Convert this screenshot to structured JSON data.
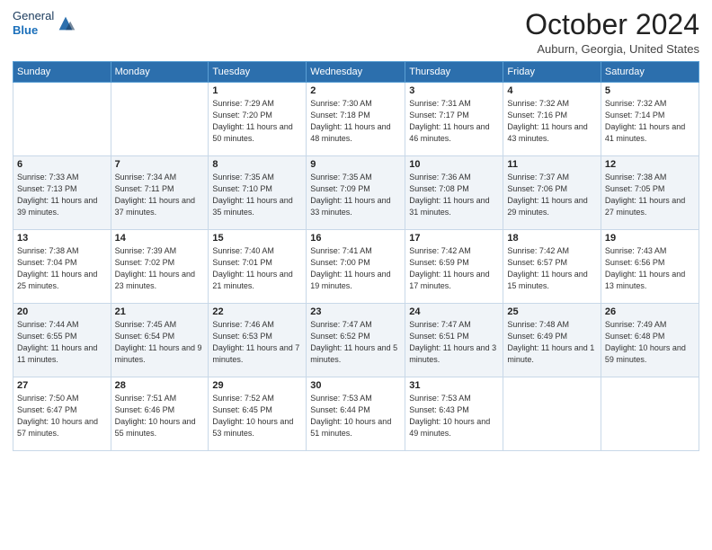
{
  "header": {
    "logo_line1": "General",
    "logo_line2": "Blue",
    "month": "October 2024",
    "location": "Auburn, Georgia, United States"
  },
  "weekdays": [
    "Sunday",
    "Monday",
    "Tuesday",
    "Wednesday",
    "Thursday",
    "Friday",
    "Saturday"
  ],
  "weeks": [
    [
      {
        "day": "",
        "info": ""
      },
      {
        "day": "",
        "info": ""
      },
      {
        "day": "1",
        "info": "Sunrise: 7:29 AM\nSunset: 7:20 PM\nDaylight: 11 hours and 50 minutes."
      },
      {
        "day": "2",
        "info": "Sunrise: 7:30 AM\nSunset: 7:18 PM\nDaylight: 11 hours and 48 minutes."
      },
      {
        "day": "3",
        "info": "Sunrise: 7:31 AM\nSunset: 7:17 PM\nDaylight: 11 hours and 46 minutes."
      },
      {
        "day": "4",
        "info": "Sunrise: 7:32 AM\nSunset: 7:16 PM\nDaylight: 11 hours and 43 minutes."
      },
      {
        "day": "5",
        "info": "Sunrise: 7:32 AM\nSunset: 7:14 PM\nDaylight: 11 hours and 41 minutes."
      }
    ],
    [
      {
        "day": "6",
        "info": "Sunrise: 7:33 AM\nSunset: 7:13 PM\nDaylight: 11 hours and 39 minutes."
      },
      {
        "day": "7",
        "info": "Sunrise: 7:34 AM\nSunset: 7:11 PM\nDaylight: 11 hours and 37 minutes."
      },
      {
        "day": "8",
        "info": "Sunrise: 7:35 AM\nSunset: 7:10 PM\nDaylight: 11 hours and 35 minutes."
      },
      {
        "day": "9",
        "info": "Sunrise: 7:35 AM\nSunset: 7:09 PM\nDaylight: 11 hours and 33 minutes."
      },
      {
        "day": "10",
        "info": "Sunrise: 7:36 AM\nSunset: 7:08 PM\nDaylight: 11 hours and 31 minutes."
      },
      {
        "day": "11",
        "info": "Sunrise: 7:37 AM\nSunset: 7:06 PM\nDaylight: 11 hours and 29 minutes."
      },
      {
        "day": "12",
        "info": "Sunrise: 7:38 AM\nSunset: 7:05 PM\nDaylight: 11 hours and 27 minutes."
      }
    ],
    [
      {
        "day": "13",
        "info": "Sunrise: 7:38 AM\nSunset: 7:04 PM\nDaylight: 11 hours and 25 minutes."
      },
      {
        "day": "14",
        "info": "Sunrise: 7:39 AM\nSunset: 7:02 PM\nDaylight: 11 hours and 23 minutes."
      },
      {
        "day": "15",
        "info": "Sunrise: 7:40 AM\nSunset: 7:01 PM\nDaylight: 11 hours and 21 minutes."
      },
      {
        "day": "16",
        "info": "Sunrise: 7:41 AM\nSunset: 7:00 PM\nDaylight: 11 hours and 19 minutes."
      },
      {
        "day": "17",
        "info": "Sunrise: 7:42 AM\nSunset: 6:59 PM\nDaylight: 11 hours and 17 minutes."
      },
      {
        "day": "18",
        "info": "Sunrise: 7:42 AM\nSunset: 6:57 PM\nDaylight: 11 hours and 15 minutes."
      },
      {
        "day": "19",
        "info": "Sunrise: 7:43 AM\nSunset: 6:56 PM\nDaylight: 11 hours and 13 minutes."
      }
    ],
    [
      {
        "day": "20",
        "info": "Sunrise: 7:44 AM\nSunset: 6:55 PM\nDaylight: 11 hours and 11 minutes."
      },
      {
        "day": "21",
        "info": "Sunrise: 7:45 AM\nSunset: 6:54 PM\nDaylight: 11 hours and 9 minutes."
      },
      {
        "day": "22",
        "info": "Sunrise: 7:46 AM\nSunset: 6:53 PM\nDaylight: 11 hours and 7 minutes."
      },
      {
        "day": "23",
        "info": "Sunrise: 7:47 AM\nSunset: 6:52 PM\nDaylight: 11 hours and 5 minutes."
      },
      {
        "day": "24",
        "info": "Sunrise: 7:47 AM\nSunset: 6:51 PM\nDaylight: 11 hours and 3 minutes."
      },
      {
        "day": "25",
        "info": "Sunrise: 7:48 AM\nSunset: 6:49 PM\nDaylight: 11 hours and 1 minute."
      },
      {
        "day": "26",
        "info": "Sunrise: 7:49 AM\nSunset: 6:48 PM\nDaylight: 10 hours and 59 minutes."
      }
    ],
    [
      {
        "day": "27",
        "info": "Sunrise: 7:50 AM\nSunset: 6:47 PM\nDaylight: 10 hours and 57 minutes."
      },
      {
        "day": "28",
        "info": "Sunrise: 7:51 AM\nSunset: 6:46 PM\nDaylight: 10 hours and 55 minutes."
      },
      {
        "day": "29",
        "info": "Sunrise: 7:52 AM\nSunset: 6:45 PM\nDaylight: 10 hours and 53 minutes."
      },
      {
        "day": "30",
        "info": "Sunrise: 7:53 AM\nSunset: 6:44 PM\nDaylight: 10 hours and 51 minutes."
      },
      {
        "day": "31",
        "info": "Sunrise: 7:53 AM\nSunset: 6:43 PM\nDaylight: 10 hours and 49 minutes."
      },
      {
        "day": "",
        "info": ""
      },
      {
        "day": "",
        "info": ""
      }
    ]
  ]
}
